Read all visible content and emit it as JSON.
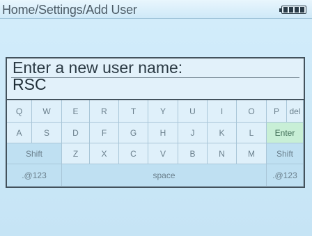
{
  "header": {
    "breadcrumb": "Home/Settings/Add User",
    "battery_icon": "battery-full-icon"
  },
  "entry": {
    "prompt": "Enter a new user name:",
    "value": "RSC"
  },
  "keyboard": {
    "rows": [
      [
        "Q",
        "W",
        "E",
        "R",
        "T",
        "Y",
        "U",
        "I",
        "O",
        "P",
        "del"
      ],
      [
        "A",
        "S",
        "D",
        "F",
        "G",
        "H",
        "J",
        "K",
        "L",
        "Enter"
      ],
      [
        "Shift",
        "Z",
        "X",
        "C",
        "V",
        "B",
        "N",
        "M",
        "Shift"
      ],
      [
        ".@123",
        "space",
        ".@123"
      ]
    ]
  },
  "colors": {
    "background": "#c9e6f6",
    "enter_key": "#c8efd6",
    "modifier_key": "#bfe0f2"
  }
}
